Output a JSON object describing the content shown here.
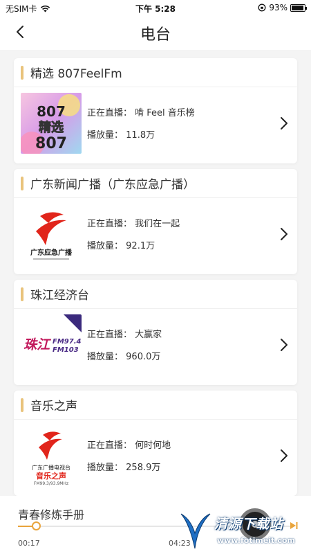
{
  "status_bar": {
    "carrier": "无SIM卡",
    "time": "下午 5:28",
    "battery_text": "93%",
    "battery_level": 0.93,
    "icons": [
      "wifi-icon",
      "orientation-lock-icon",
      "battery-icon"
    ]
  },
  "nav": {
    "title": "电台",
    "back_icon": "chevron-left-icon"
  },
  "stations": [
    {
      "name": "精选 807FeelFm",
      "live_prefix": "正在直播：",
      "live": "啃 Feel 音乐榜",
      "plays_prefix": "播放量：",
      "plays": "11.8万",
      "logo_text": "精选 807"
    },
    {
      "name": "广东新闻广播（广东应急广播）",
      "live_prefix": "正在直播：",
      "live": "我们在一起",
      "plays_prefix": "播放量：",
      "plays": "92.1万",
      "logo_text": "广东应急广播"
    },
    {
      "name": "珠江经济台",
      "live_prefix": "正在直播：",
      "live": "大赢家",
      "plays_prefix": "播放量：",
      "plays": "960.0万",
      "logo_text": "珠江 FM97.4 FM103"
    },
    {
      "name": "音乐之声",
      "live_prefix": "正在直播：",
      "live": "何时何地",
      "plays_prefix": "播放量：",
      "plays": "258.9万",
      "logo_text": "音乐之声"
    }
  ],
  "player": {
    "title": "青春修炼手册",
    "elapsed": "00:17",
    "duration": "04:23",
    "progress": 0.065
  },
  "watermark": {
    "text": "清源下载站",
    "url": "www.fotimeit.com"
  },
  "colors": {
    "accent": "#e9c37b",
    "progress": "#e9a43b",
    "background": "#f4f4f4"
  }
}
